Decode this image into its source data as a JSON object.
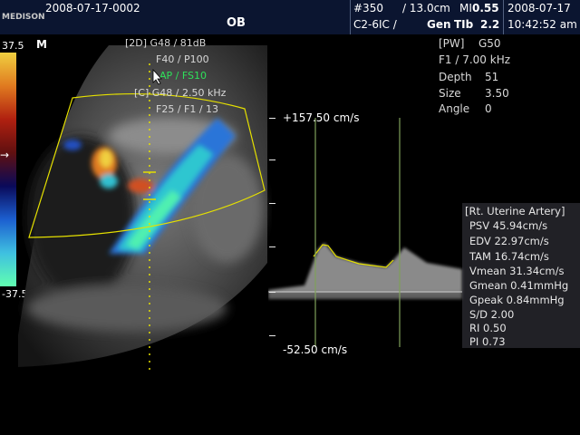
{
  "header": {
    "brand": "MEDISON",
    "date_id": "2008-07-17-0002",
    "application": "OB",
    "probe_no": "#350",
    "probe": "C2-6IC /",
    "depth": "/ 13.0cm",
    "mi_label": "MI",
    "mi_value": "0.55",
    "gen_label": "Gen",
    "tib_label": "TIb",
    "tib_value": "2.2",
    "date": "2008-07-17",
    "time": "10:42:52 am"
  },
  "colorbar": {
    "top_value": "37.5",
    "bottom_value": "-37.5",
    "colors": [
      "#f0d040",
      "#e07a20",
      "#b02010",
      "#601010",
      "#0a0a5a",
      "#1c5fd0",
      "#3fc0e0",
      "#60ffb0"
    ]
  },
  "left_image": {
    "mode_2d": "[2D] G48 / 81dB",
    "frame": "F40 / P100",
    "harmonic": "AP / FS10",
    "color": "[C] G48 / 2.50 kHz",
    "color_filter": "F25 / F1 / 13",
    "orientation_marker": "M"
  },
  "pw_settings": {
    "mode": "[PW]",
    "gain": "G50",
    "filter": "F1 / 7.00 kHz",
    "depth_label": "Depth",
    "depth_value": "51",
    "size_label": "Size",
    "size_value": "3.50",
    "angle_label": "Angle",
    "angle_value": "0"
  },
  "spectrum": {
    "top_velocity": "+157.50 cm/s",
    "bottom_velocity": "-52.50 cm/s"
  },
  "measurements": {
    "title": "[Rt. Uterine Artery]",
    "rows": [
      "PSV 45.94cm/s",
      "EDV 22.97cm/s",
      "TAM 16.74cm/s",
      "Vmean 31.34cm/s",
      "Gmean 0.41mmHg",
      "Gpeak 0.84mmHg",
      "S/D 2.00",
      "RI 0.50",
      "PI 0.73"
    ]
  },
  "colors": {
    "header_bg": "#0b1530",
    "caliper": "#e5e000",
    "cursor_line": "#7fa05a"
  }
}
